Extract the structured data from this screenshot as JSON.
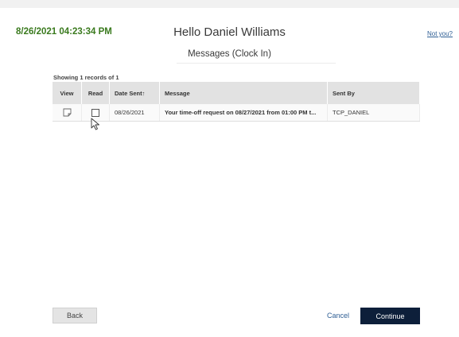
{
  "header": {
    "datetime": "8/26/2021 04:23:34 PM",
    "greeting": "Hello Daniel Williams",
    "not_you_link": "Not you?"
  },
  "page": {
    "subtitle": "Messages (Clock In)",
    "records_summary": "Showing 1 records of 1"
  },
  "table": {
    "columns": {
      "view": "View",
      "read": "Read",
      "date_sent": "Date Sent↑",
      "message": "Message",
      "sent_by": "Sent By"
    },
    "rows": [
      {
        "view_icon": "note-icon",
        "read_checked": false,
        "date_sent": "08/26/2021",
        "message": "Your time-off request on 08/27/2021 from 01:00 PM t...",
        "sent_by": "TCP_DANIEL"
      }
    ]
  },
  "footer": {
    "back_label": "Back",
    "cancel_label": "Cancel",
    "continue_label": "Continue"
  },
  "colors": {
    "datetime_green": "#3a7a1e",
    "link_blue": "#2e5e94",
    "continue_navy": "#0d1f3a",
    "header_gray": "#e2e2e2"
  }
}
